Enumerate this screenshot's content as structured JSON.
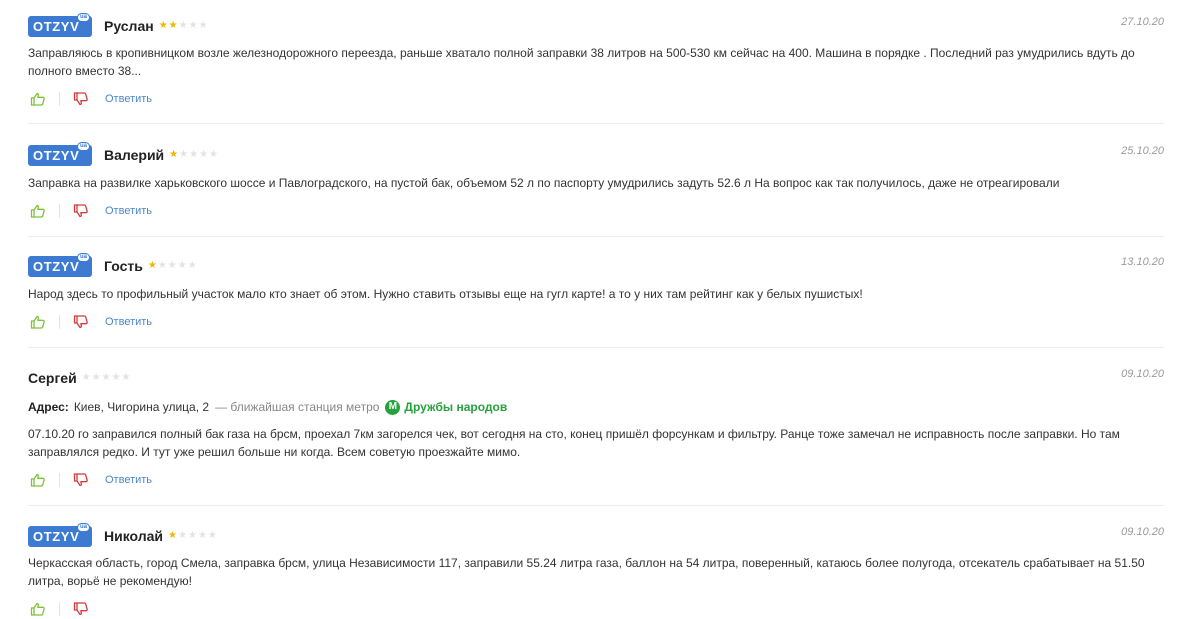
{
  "reply_label": "Ответить",
  "logo_text": "OTZYV",
  "logo_badge": "ua",
  "colors": {
    "logo": "#3d7bd3",
    "star_on": "#f4b400",
    "star_off": "#e3e3e3",
    "like": "#7dc23b",
    "dislike": "#d23b3b",
    "link": "#4a85c9",
    "metro": "#27a03e"
  },
  "icons": {
    "like": "thumbs-up-icon",
    "dislike": "thumbs-down-icon",
    "metro": "metro-m-icon",
    "star": "star-icon"
  },
  "reviews": [
    {
      "author": "Руслан",
      "rating": 2,
      "date": "27.10.20",
      "has_logo": true,
      "text": "Заправляюсь в кропивницком возле железнодорожного переезда, раньше хватало полной заправки 38 литров на 500-530 км сейчас на 400. Машина в порядке . Последний раз умудрились вдуть до полного вместо 38..."
    },
    {
      "author": "Валерий",
      "rating": 1,
      "date": "25.10.20",
      "has_logo": true,
      "text": "Заправка на развилке харьковского шоссе и Павлоградского, на пустой бак, объемом 52 л по паспорту умудрились задуть 52.6 л На вопрос как так получилось, даже не отреагировали"
    },
    {
      "author": "Гость",
      "rating": 1,
      "date": "13.10.20",
      "has_logo": true,
      "text": "Народ здесь то профильный участок мало кто знает об этом. Нужно ставить отзывы еще на гугл карте! а то у них там рейтинг как у белых пушистых!"
    },
    {
      "author": "Сергей",
      "rating": 0,
      "date": "09.10.20",
      "has_logo": false,
      "address": {
        "label": "Адрес:",
        "street": "Киев, Чигорина улица, 2",
        "metro_note": "— ближайшая станция метро",
        "metro_icon": "M",
        "metro_name": "Дружбы народов"
      },
      "text": "07.10.20 го заправился полный бак газа на брсм, проехал 7км загорелся чек, вот сегодня на сто, конец пришёл форсункам и фильтру. Ранце тоже замечал не исправность после заправки. Но там заправлялся редко. И тут уже решил больше ни когда. Всем советую проезжайте мимо."
    },
    {
      "author": "Николай",
      "rating": 1,
      "date": "09.10.20",
      "has_logo": true,
      "text": "Черкасская область, город Смела, заправка брсм, улица Независимости 117, заправили 55.24 литра газа, баллон на 54 литра, поверенный, катаюсь более полугода, отсекатель срабатывает на 51.50 литра, ворьё не рекомендую!"
    }
  ]
}
